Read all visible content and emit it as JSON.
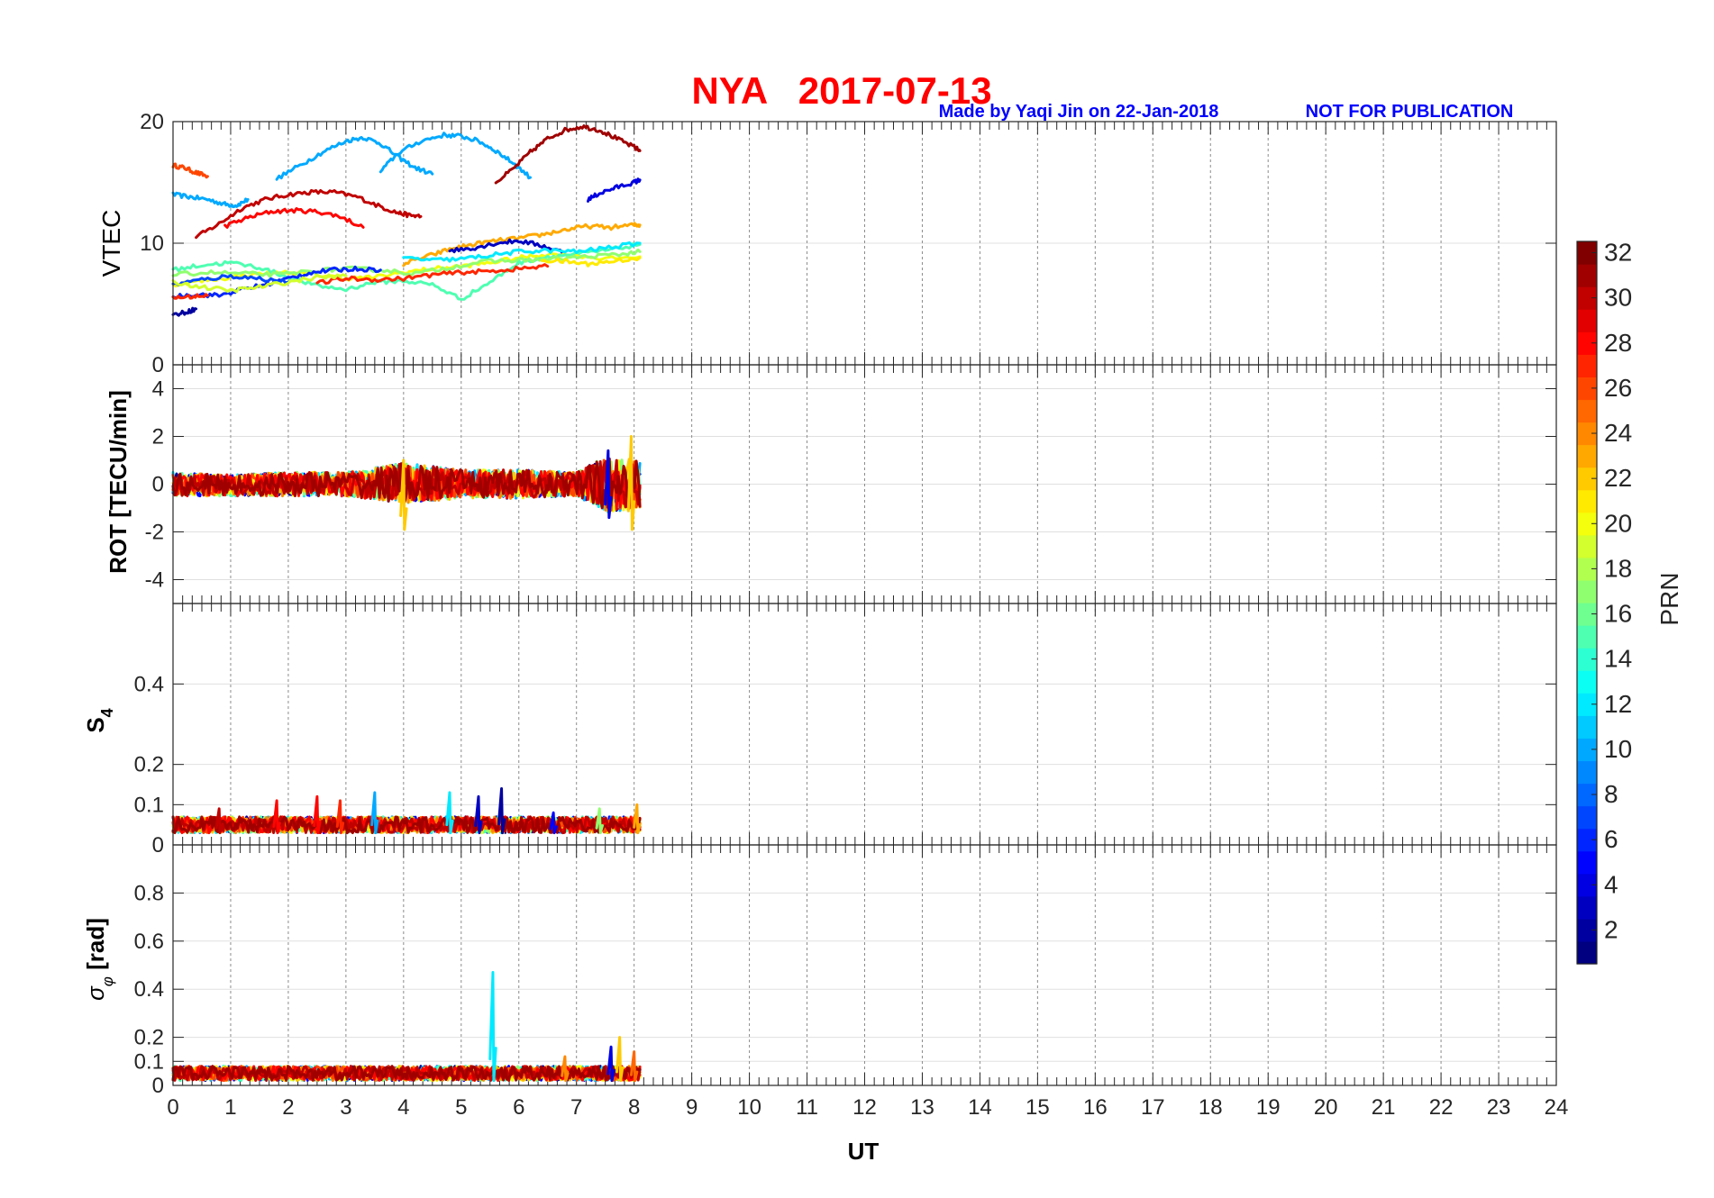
{
  "header": {
    "title": "NYA   2017-07-13",
    "credit": "Made by Yaqi Jin on 22-Jan-2018",
    "notice": "NOT FOR PUBLICATION"
  },
  "colors": {
    "title": "#ff0000",
    "credit": "#0000ff",
    "colormap": "jet"
  },
  "chart_data": [
    {
      "type": "line",
      "panel": "vtec",
      "ylabel": "VTEC",
      "ylim": [
        0,
        20
      ],
      "yticks": [
        "0",
        "10",
        "20"
      ],
      "xlim": [
        0,
        24
      ],
      "grid": true,
      "series": [
        {
          "prn": 26,
          "x": [
            0.0,
            0.2,
            0.4,
            0.6
          ],
          "y": [
            16.4,
            16.2,
            15.8,
            15.5
          ]
        },
        {
          "prn": 10,
          "x": [
            0.0,
            0.3,
            0.6,
            0.9,
            1.1,
            1.3
          ],
          "y": [
            14.0,
            13.8,
            13.6,
            13.2,
            13.1,
            13.6
          ]
        },
        {
          "prn": 30,
          "x": [
            0.4,
            0.8,
            1.2,
            1.6,
            2.0,
            2.4,
            2.8,
            3.2,
            3.6,
            3.9,
            4.1,
            4.3
          ],
          "y": [
            10.5,
            11.6,
            12.9,
            13.6,
            14.0,
            14.2,
            14.2,
            13.8,
            13.0,
            12.5,
            12.3,
            12.2
          ]
        },
        {
          "prn": 28,
          "x": [
            0.9,
            1.3,
            1.7,
            2.1,
            2.5,
            2.9,
            3.3
          ],
          "y": [
            11.4,
            12.1,
            12.6,
            12.7,
            12.6,
            12.2,
            11.3
          ]
        },
        {
          "prn": 10,
          "x": [
            1.8,
            2.2,
            2.6,
            3.0,
            3.3,
            3.6,
            3.9,
            4.2,
            4.5
          ],
          "y": [
            15.3,
            16.4,
            17.5,
            18.4,
            18.7,
            18.2,
            17.1,
            16.2,
            15.7
          ]
        },
        {
          "prn": 10,
          "x": [
            3.6,
            3.9,
            4.3,
            4.7,
            5.0,
            5.3,
            5.6,
            5.9,
            6.2
          ],
          "y": [
            15.9,
            17.4,
            18.4,
            18.9,
            18.8,
            18.4,
            17.6,
            16.6,
            15.4
          ]
        },
        {
          "prn": 31,
          "x": [
            5.6,
            5.9,
            6.2,
            6.5,
            6.8,
            7.1,
            7.4,
            7.7,
            8.0,
            8.1
          ],
          "y": [
            15.0,
            16.1,
            17.5,
            18.6,
            19.3,
            19.6,
            19.3,
            18.6,
            17.9,
            17.6
          ]
        },
        {
          "prn": 4,
          "x": [
            7.2,
            7.4,
            7.7,
            8.0,
            8.1
          ],
          "y": [
            13.6,
            14.1,
            14.6,
            15.0,
            15.2
          ]
        },
        {
          "prn": 23,
          "x": [
            4.0,
            4.4,
            4.8,
            5.2,
            5.6,
            6.0,
            6.4,
            6.8,
            7.2,
            7.6,
            8.0,
            8.1
          ],
          "y": [
            8.3,
            8.9,
            9.5,
            9.9,
            10.2,
            10.4,
            10.7,
            11.1,
            11.4,
            11.3,
            11.5,
            11.5
          ]
        },
        {
          "prn": 3,
          "x": [
            4.8,
            5.2,
            5.6,
            6.0,
            6.4,
            6.8
          ],
          "y": [
            9.4,
            9.6,
            10.0,
            10.2,
            9.8,
            9.2
          ]
        },
        {
          "prn": 20,
          "x": [
            0.0,
            0.5,
            1.0,
            1.5,
            2.0,
            2.5,
            3.0,
            3.5,
            4.0,
            4.5,
            5.0,
            5.5,
            6.0,
            6.5,
            7.0,
            7.5,
            8.1
          ],
          "y": [
            6.6,
            6.9,
            7.2,
            7.5,
            7.6,
            7.4,
            7.1,
            7.2,
            7.6,
            7.9,
            8.1,
            8.4,
            8.8,
            9.1,
            9.0,
            8.7,
            8.9
          ]
        },
        {
          "prn": 15,
          "x": [
            0.0,
            0.5,
            1.0,
            1.5,
            2.0,
            2.5,
            3.0,
            3.5,
            4.0,
            4.5,
            5.0,
            5.5,
            6.0,
            6.5,
            7.0,
            7.5,
            8.1
          ],
          "y": [
            7.8,
            8.2,
            8.4,
            8.0,
            7.2,
            6.5,
            6.2,
            6.8,
            6.9,
            6.6,
            5.4,
            6.8,
            8.4,
            8.9,
            9.1,
            9.4,
            9.9
          ]
        },
        {
          "prn": 17,
          "x": [
            0.0,
            0.6,
            1.2,
            1.8,
            2.4,
            3.0,
            3.6,
            4.2,
            4.8,
            5.4,
            6.0,
            6.6,
            7.2,
            7.8,
            8.1
          ],
          "y": [
            7.4,
            7.6,
            7.5,
            7.4,
            7.7,
            7.9,
            7.8,
            7.5,
            8.0,
            8.5,
            8.6,
            8.7,
            8.9,
            9.1,
            9.3
          ]
        },
        {
          "prn": 12,
          "x": [
            4.0,
            4.5,
            5.0,
            5.5,
            6.0,
            6.5,
            7.0,
            7.5,
            8.1
          ],
          "y": [
            8.8,
            8.6,
            8.7,
            9.0,
            9.3,
            9.4,
            9.3,
            9.6,
            10.0
          ]
        },
        {
          "prn": 6,
          "x": [
            0.0,
            0.4,
            0.8,
            1.2,
            1.6,
            2.0,
            2.4,
            2.8,
            3.2,
            3.6
          ],
          "y": [
            5.6,
            5.8,
            5.7,
            6.2,
            6.6,
            7.1,
            7.6,
            7.8,
            7.9,
            7.8
          ]
        },
        {
          "prn": 2,
          "x": [
            0.0,
            0.2,
            0.4
          ],
          "y": [
            4.1,
            4.3,
            4.6
          ]
        },
        {
          "prn": 27,
          "x": [
            0.0,
            0.3,
            0.6
          ],
          "y": [
            5.5,
            5.6,
            5.7
          ]
        },
        {
          "prn": 7,
          "x": [
            0.0,
            0.5,
            1.0,
            1.5,
            2.0
          ],
          "y": [
            6.6,
            7.0,
            7.3,
            7.1,
            6.8
          ]
        },
        {
          "prn": 27,
          "x": [
            2.5,
            3.0,
            3.5,
            4.0,
            4.5,
            5.0,
            5.5,
            6.0,
            6.5
          ],
          "y": [
            6.7,
            7.1,
            7.0,
            7.1,
            7.4,
            7.6,
            7.7,
            7.9,
            8.1
          ]
        },
        {
          "prn": 19,
          "x": [
            0.0,
            0.5,
            1.0,
            1.5,
            2.0,
            2.5,
            3.0
          ],
          "y": [
            6.8,
            6.4,
            6.1,
            6.4,
            6.8,
            7.2,
            7.3
          ]
        },
        {
          "prn": 21,
          "x": [
            6.4,
            6.8,
            7.2,
            7.6,
            8.1
          ],
          "y": [
            8.6,
            8.5,
            8.3,
            8.5,
            8.8
          ]
        }
      ]
    },
    {
      "type": "line",
      "panel": "rot",
      "ylabel": "ROT [TECU/min]",
      "ylim": [
        -5,
        5
      ],
      "yticks": [
        "-4",
        "-2",
        "0",
        "2",
        "4"
      ],
      "xlim": [
        0,
        24
      ],
      "grid": true,
      "x_range": [
        0,
        8.1
      ],
      "envelope": [
        {
          "x": [
            0,
            1,
            2,
            3,
            4,
            5,
            6,
            7,
            7.5,
            8.1
          ],
          "lo": [
            -0.5,
            -0.5,
            -0.5,
            -0.5,
            -0.8,
            -0.6,
            -0.6,
            -0.5,
            -1.2,
            -1.0
          ],
          "hi": [
            0.5,
            0.4,
            0.5,
            0.5,
            0.9,
            0.6,
            0.6,
            0.5,
            1.2,
            1.0
          ]
        }
      ],
      "spikes": [
        {
          "prn": 22,
          "x": 4.0,
          "lo": -1.9,
          "hi": 1.0
        },
        {
          "prn": 4,
          "x": 7.55,
          "lo": -1.4,
          "hi": 1.4
        },
        {
          "prn": 22,
          "x": 7.95,
          "lo": -1.9,
          "hi": 2.0
        }
      ]
    },
    {
      "type": "line",
      "panel": "s4",
      "ylabel": "S4",
      "ylim": [
        0,
        0.6
      ],
      "yticks": [
        "0",
        "0.1",
        "0.2",
        "0.4"
      ],
      "xlim": [
        0,
        24
      ],
      "grid": true,
      "x_range": [
        0,
        8.1
      ],
      "baseline": [
        0.03,
        0.07
      ],
      "spikes": [
        {
          "prn": 30,
          "x": 0.8,
          "hi": 0.09
        },
        {
          "prn": 28,
          "x": 1.8,
          "hi": 0.11
        },
        {
          "prn": 28,
          "x": 2.5,
          "hi": 0.12
        },
        {
          "prn": 27,
          "x": 2.9,
          "hi": 0.11
        },
        {
          "prn": 10,
          "x": 3.5,
          "hi": 0.13
        },
        {
          "prn": 12,
          "x": 4.8,
          "hi": 0.13
        },
        {
          "prn": 3,
          "x": 5.3,
          "hi": 0.12
        },
        {
          "prn": 2,
          "x": 5.7,
          "hi": 0.14
        },
        {
          "prn": 5,
          "x": 6.6,
          "hi": 0.08
        },
        {
          "prn": 17,
          "x": 7.4,
          "hi": 0.09
        },
        {
          "prn": 23,
          "x": 8.05,
          "hi": 0.1
        }
      ]
    },
    {
      "type": "line",
      "panel": "sigma_phi",
      "ylabel": "σφ [rad]",
      "ylim": [
        0,
        1
      ],
      "yticks": [
        "0",
        "0.1",
        "0.2",
        "0.4",
        "0.6",
        "0.8"
      ],
      "xlim": [
        0,
        24
      ],
      "xticks": [
        "0",
        "1",
        "2",
        "3",
        "4",
        "5",
        "6",
        "7",
        "8",
        "9",
        "10",
        "11",
        "12",
        "13",
        "14",
        "15",
        "16",
        "17",
        "18",
        "19",
        "20",
        "21",
        "22",
        "23",
        "24"
      ],
      "xlabel": "UT",
      "grid": true,
      "x_range": [
        0,
        8.1
      ],
      "baseline": [
        0.02,
        0.08
      ],
      "spikes": [
        {
          "prn": 12,
          "x": 5.55,
          "hi": 0.47
        },
        {
          "prn": 22,
          "x": 7.75,
          "hi": 0.2
        },
        {
          "prn": 4,
          "x": 7.6,
          "hi": 0.16
        },
        {
          "prn": 24,
          "x": 6.8,
          "hi": 0.12
        },
        {
          "prn": 25,
          "x": 8.0,
          "hi": 0.14
        }
      ]
    }
  ],
  "colorbar": {
    "label": "PRN",
    "range": [
      1,
      32
    ],
    "ticks": [
      "2",
      "4",
      "6",
      "8",
      "10",
      "12",
      "14",
      "16",
      "18",
      "20",
      "22",
      "24",
      "26",
      "28",
      "30",
      "32"
    ]
  }
}
